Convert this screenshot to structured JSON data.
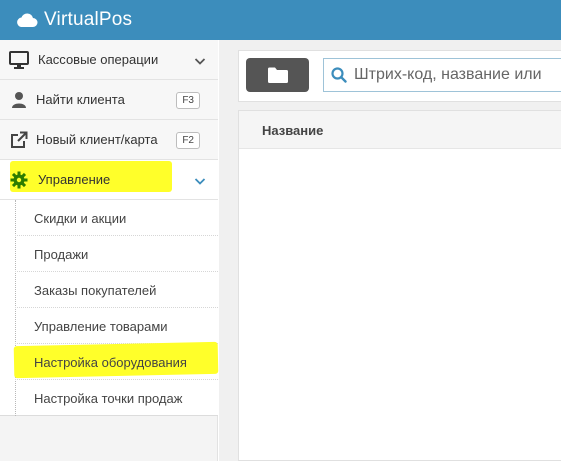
{
  "app": {
    "title": "VirtualPos"
  },
  "sidebar": {
    "items": [
      {
        "label": "Кассовые операции",
        "icon": "monitor-icon"
      },
      {
        "label": "Найти клиента",
        "icon": "user-icon",
        "shortcut": "F3"
      },
      {
        "label": "Новый клиент/карта",
        "icon": "external-link-icon",
        "shortcut": "F2"
      },
      {
        "label": "Управление",
        "icon": "gear-icon",
        "expanded": true
      }
    ],
    "submenu": [
      {
        "label": "Скидки и акции"
      },
      {
        "label": "Продажи"
      },
      {
        "label": "Заказы покупателей"
      },
      {
        "label": "Управление товарами"
      },
      {
        "label": "Настройка оборудования"
      },
      {
        "label": "Настройка точки продаж"
      }
    ]
  },
  "toolbar": {
    "search_placeholder": "Штрих-код, название или"
  },
  "table": {
    "columns": [
      "Название"
    ]
  },
  "colors": {
    "header": "#3c8dbc",
    "highlight": "#ffff2a",
    "gear": "#2e7d00",
    "folder_button": "#555555"
  }
}
